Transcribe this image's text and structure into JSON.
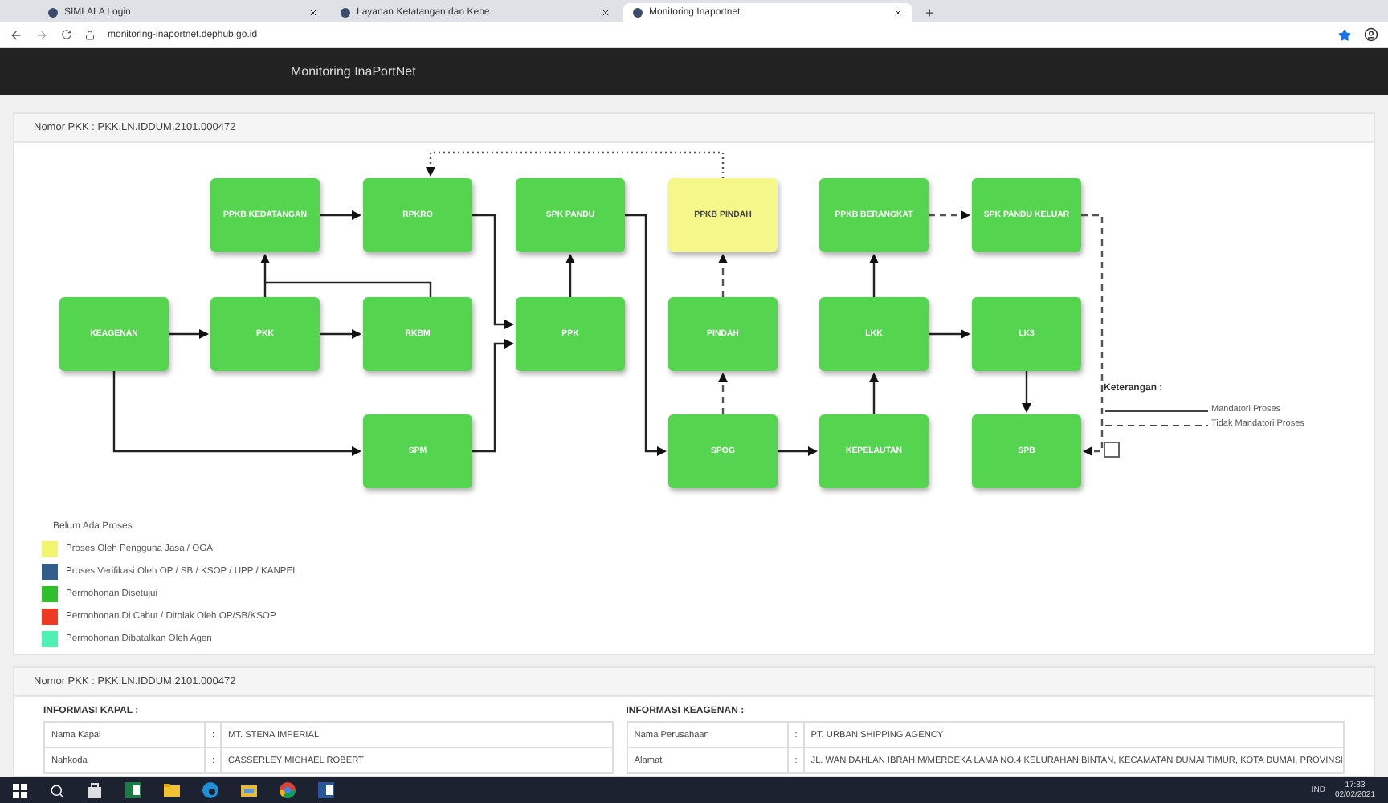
{
  "browser": {
    "tabs": [
      {
        "title": "SIMLALA Login",
        "selected": false
      },
      {
        "title": "Layanan Ketatangan dan Kebe",
        "selected": false
      },
      {
        "title": "Monitoring Inaportnet",
        "selected": true
      }
    ],
    "new_tab": "+",
    "url": "monitoring-inaportnet.dephub.go.id"
  },
  "header": {
    "title": "Monitoring InaPortNet"
  },
  "flow_panel": {
    "title": "Nomor PKK : PKK.LN.IDDUM.2101.000472",
    "nodes": [
      {
        "label": "PPKB KEDATANGAN",
        "color": "#55d44f"
      },
      {
        "label": "RPKRO",
        "color": "#55d44f"
      },
      {
        "label": "SPK PANDU",
        "color": "#55d44f"
      },
      {
        "label": "PPKB PINDAH",
        "color": "#f5f78a"
      },
      {
        "label": "PPKB BERANGKAT",
        "color": "#55d44f"
      },
      {
        "label": "SPK PANDU KELUAR",
        "color": "#55d44f"
      },
      {
        "label": "KEAGENAN",
        "color": "#55d44f"
      },
      {
        "label": "PKK",
        "color": "#55d44f"
      },
      {
        "label": "RKBM",
        "color": "#55d44f"
      },
      {
        "label": "PPK",
        "color": "#55d44f"
      },
      {
        "label": "PINDAH",
        "color": "#55d44f"
      },
      {
        "label": "LKK",
        "color": "#55d44f"
      },
      {
        "label": "LK3",
        "color": "#55d44f"
      },
      {
        "label": "SPM",
        "color": "#55d44f"
      },
      {
        "label": "SPOG",
        "color": "#55d44f"
      },
      {
        "label": "KEPELAUTAN",
        "color": "#55d44f"
      },
      {
        "label": "SPB",
        "color": "#55d44f"
      }
    ],
    "notes": {
      "title": "Keterangan :",
      "items": [
        {
          "label": "Mandatori Proses",
          "kind": "solid"
        },
        {
          "label": "Tidak Mandatori Proses",
          "kind": "dashed"
        }
      ]
    },
    "legend_title": "Belum Ada Proses",
    "legend": [
      {
        "label": "Proses Oleh Pengguna Jasa / OGA",
        "color": "#f2f56e"
      },
      {
        "label": "Proses Verifikasi Oleh OP / SB / KSOP / UPP / KANPEL",
        "color": "#2f5f8a"
      },
      {
        "label": "Permohonan Disetujui",
        "color": "#2fbf2a"
      },
      {
        "label": "Permohonan Di Cabut / Ditolak Oleh OP/SB/KSOP",
        "color": "#ee3a22"
      },
      {
        "label": "Permohonan Dibatalkan Oleh Agen",
        "color": "#4ff0b4"
      }
    ]
  },
  "info_panel": {
    "title": "Nomor PKK : PKK.LN.IDDUM.2101.000472",
    "sections": [
      {
        "title": "INFORMASI KAPAL :",
        "rows": [
          {
            "label": "Nama Kapal",
            "sep": ":",
            "value": "MT. STENA IMPERIAL"
          },
          {
            "label": "Nahkoda",
            "sep": ":",
            "value": "CASSERLEY MICHAEL ROBERT"
          }
        ]
      },
      {
        "title": "INFORMASI KEAGENAN :",
        "rows": [
          {
            "label": "Nama Perusahaan",
            "sep": ":",
            "value": "PT. URBAN SHIPPING AGENCY"
          },
          {
            "label": "Alamat",
            "sep": ":",
            "value": "JL. WAN DAHLAN IBRAHIM/MERDEKA LAMA NO.4 KELURAHAN BINTAN, KECAMATAN DUMAI TIMUR, KOTA DUMAI, PROVINSI"
          }
        ]
      }
    ]
  },
  "taskbar": {
    "language": "IND",
    "time": "17:33",
    "date": "02/02/2021"
  }
}
